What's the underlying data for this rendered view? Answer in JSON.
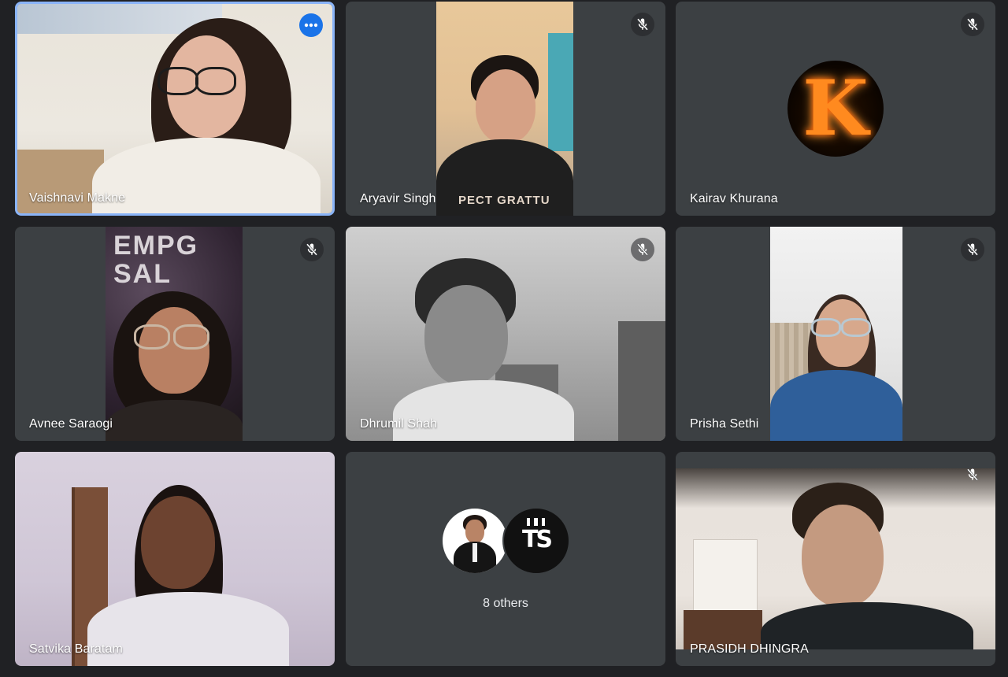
{
  "participants": [
    {
      "name": "Vaishnavi Makne",
      "status": "speaking"
    },
    {
      "name": "Aryavir Singh",
      "status": "muted"
    },
    {
      "name": "Kairav Khurana",
      "status": "muted",
      "avatar_letter": "K"
    },
    {
      "name": "Avnee Saraogi",
      "status": "muted"
    },
    {
      "name": "Dhrumil Shah",
      "status": "muted"
    },
    {
      "name": "Prisha Sethi",
      "status": "muted"
    },
    {
      "name": "Satvika Baratam",
      "status": "unmuted"
    },
    {
      "name": "PRASIDH DHINGRA",
      "status": "muted"
    }
  ],
  "others_tile": {
    "label": "8 others",
    "avatar_text": "TS"
  },
  "background_text": {
    "shirt_print": "PECT GRATTU",
    "banner_letters": "EMPG SAL"
  },
  "icons": {
    "mute": "mic-off-icon",
    "options": "more-options-icon"
  },
  "colors": {
    "background": "#202124",
    "tile": "#3c4043",
    "active_border": "#8ab4f8",
    "options_button": "#1a73e8"
  }
}
